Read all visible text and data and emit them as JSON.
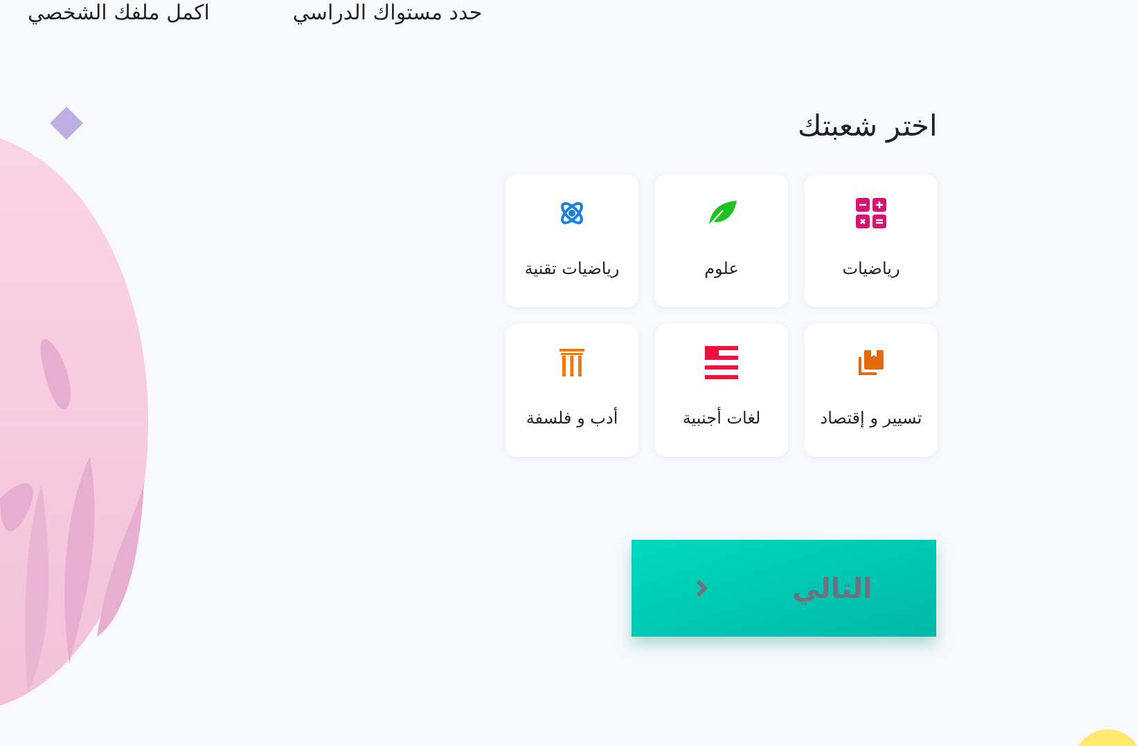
{
  "top_links": [
    "حدد مستواك الدراسي",
    "اكمل ملفك الشخصي"
  ],
  "title": "اختر شعبتك",
  "branches": [
    {
      "label": "رياضيات"
    },
    {
      "label": "علوم"
    },
    {
      "label": "رياضيات تقنية"
    },
    {
      "label": "تسيير و إقتصاد"
    },
    {
      "label": "لغات أجنبية"
    },
    {
      "label": "أدب و فلسفة"
    }
  ],
  "next_button": "التالي"
}
